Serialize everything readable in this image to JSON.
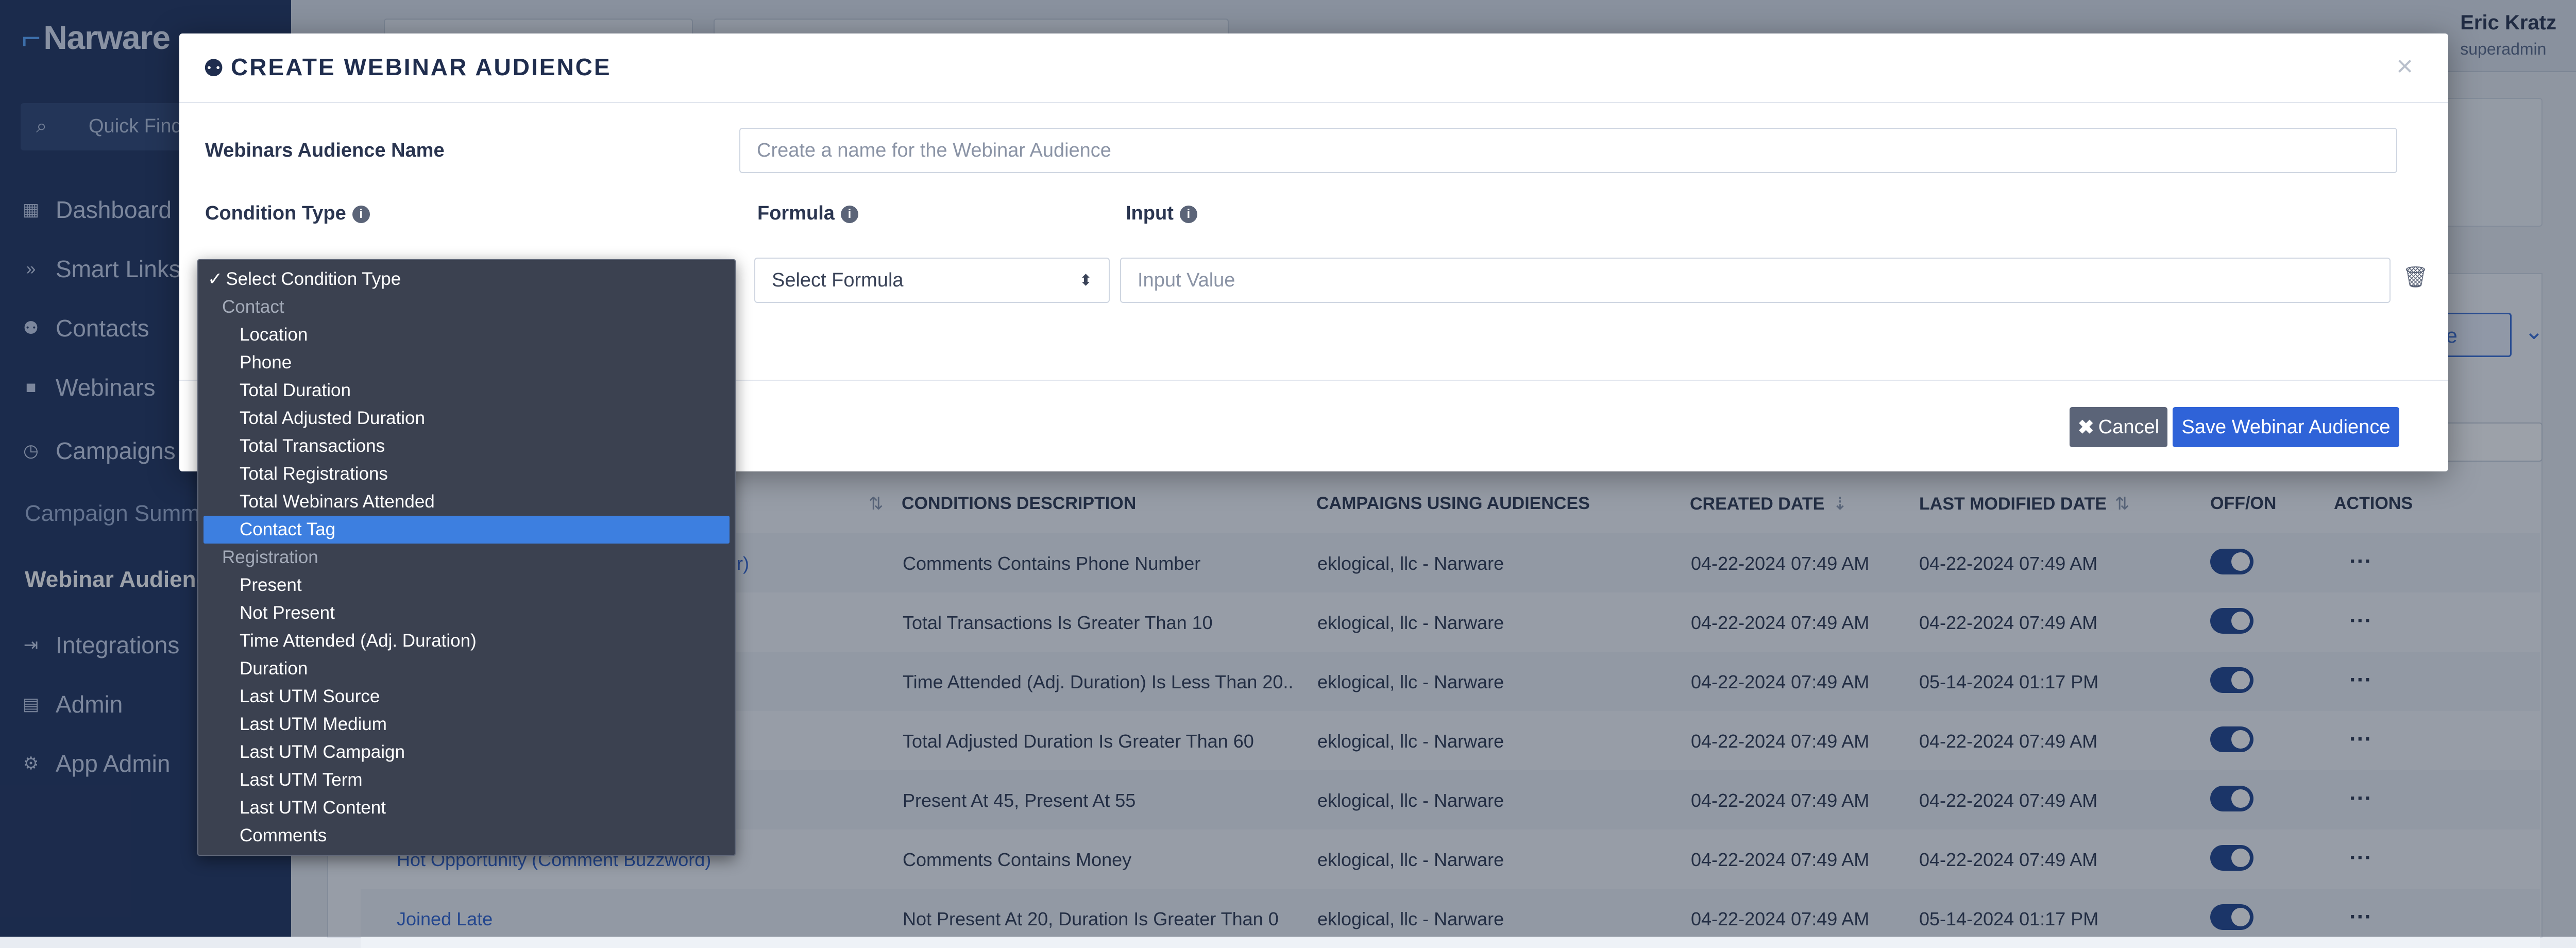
{
  "app": {
    "logo": "Narware",
    "quick_find": "Quick Find",
    "user": {
      "name": "Eric Kratz",
      "role": "superadmin"
    }
  },
  "sidebar": {
    "items": [
      {
        "label": "Dashboard",
        "icon": "grid-icon"
      },
      {
        "label": "Smart Links",
        "icon": "double-chevron-icon"
      },
      {
        "label": "Contacts",
        "icon": "users-icon"
      },
      {
        "label": "Webinars",
        "icon": "video-icon"
      },
      {
        "label": "Campaigns",
        "icon": "clock-icon"
      }
    ],
    "subitems": [
      {
        "label": "Campaign Summ"
      },
      {
        "label": "Webinar Audience"
      }
    ],
    "items_bottom": [
      {
        "label": "Integrations",
        "icon": "sign-in-icon"
      },
      {
        "label": "Admin",
        "icon": "clipboard-icon"
      },
      {
        "label": "App Admin",
        "icon": "cogs-icon"
      }
    ]
  },
  "list": {
    "add_button": "ence",
    "headers": {
      "conditions": "CONDITIONS DESCRIPTION",
      "campaigns": "CAMPAIGNS USING AUDIENCES",
      "created": "CREATED DATE",
      "modified": "LAST MODIFIED DATE",
      "offon": "OFF/ON",
      "actions": "ACTIONS"
    },
    "rows": [
      {
        "name": "ber)",
        "conditions": "Comments Contains Phone Number",
        "campaign": "eklogical, llc - Narware",
        "created": "04-22-2024 07:49 AM",
        "modified": "04-22-2024 07:49 AM"
      },
      {
        "name": "",
        "conditions": "Total Transactions Is Greater Than 10",
        "campaign": "eklogical, llc - Narware",
        "created": "04-22-2024 07:49 AM",
        "modified": "04-22-2024 07:49 AM"
      },
      {
        "name": "",
        "conditions": "Time Attended (Adj. Duration) Is Less Than 20...",
        "campaign": "eklogical, llc - Narware",
        "created": "04-22-2024 07:49 AM",
        "modified": "05-14-2024 01:17 PM"
      },
      {
        "name": "",
        "conditions": "Total Adjusted Duration Is Greater Than 60",
        "campaign": "eklogical, llc - Narware",
        "created": "04-22-2024 07:49 AM",
        "modified": "04-22-2024 07:49 AM"
      },
      {
        "name": "",
        "conditions": "Present At 45, Present At 55",
        "campaign": "eklogical, llc - Narware",
        "created": "04-22-2024 07:49 AM",
        "modified": "04-22-2024 07:49 AM"
      },
      {
        "name": "Hot Opportunity (Comment Buzzword)",
        "conditions": "Comments Contains Money",
        "campaign": "eklogical, llc - Narware",
        "created": "04-22-2024 07:49 AM",
        "modified": "04-22-2024 07:49 AM"
      },
      {
        "name": "Joined Late",
        "conditions": "Not Present At 20, Duration Is Greater Than 0",
        "campaign": "eklogical, llc - Narware",
        "created": "04-22-2024 07:49 AM",
        "modified": "05-14-2024 01:17 PM"
      }
    ]
  },
  "modal": {
    "title": "CREATE WEBINAR AUDIENCE",
    "close": "×",
    "name_label": "Webinars Audience Name",
    "name_placeholder": "Create a name for the Webinar Audience",
    "condition_label": "Condition Type",
    "formula_label": "Formula",
    "input_label": "Input",
    "formula_value": "Select Formula",
    "input_placeholder": "Input Value",
    "cancel": "Cancel",
    "save": "Save Webinar Audience"
  },
  "dropdown": {
    "placeholder": "Select Condition Type",
    "groups": [
      {
        "label": "Contact",
        "options": [
          "Location",
          "Phone",
          "Total Duration",
          "Total Adjusted Duration",
          "Total Transactions",
          "Total Registrations",
          "Total Webinars Attended",
          "Contact Tag"
        ]
      },
      {
        "label": "Registration",
        "options": [
          "Present",
          "Not Present",
          "Time Attended (Adj. Duration)",
          "Duration",
          "Last UTM Source",
          "Last UTM Medium",
          "Last UTM Campaign",
          "Last UTM Term",
          "Last UTM Content",
          "Comments"
        ]
      }
    ],
    "highlighted": "Contact Tag"
  },
  "colors": {
    "sidebar_bg": "#22355f",
    "primary": "#2f63d8",
    "cancel_bg": "#5b6478",
    "dropdown_bg": "#3b4150",
    "highlight": "#3d7fe0"
  }
}
